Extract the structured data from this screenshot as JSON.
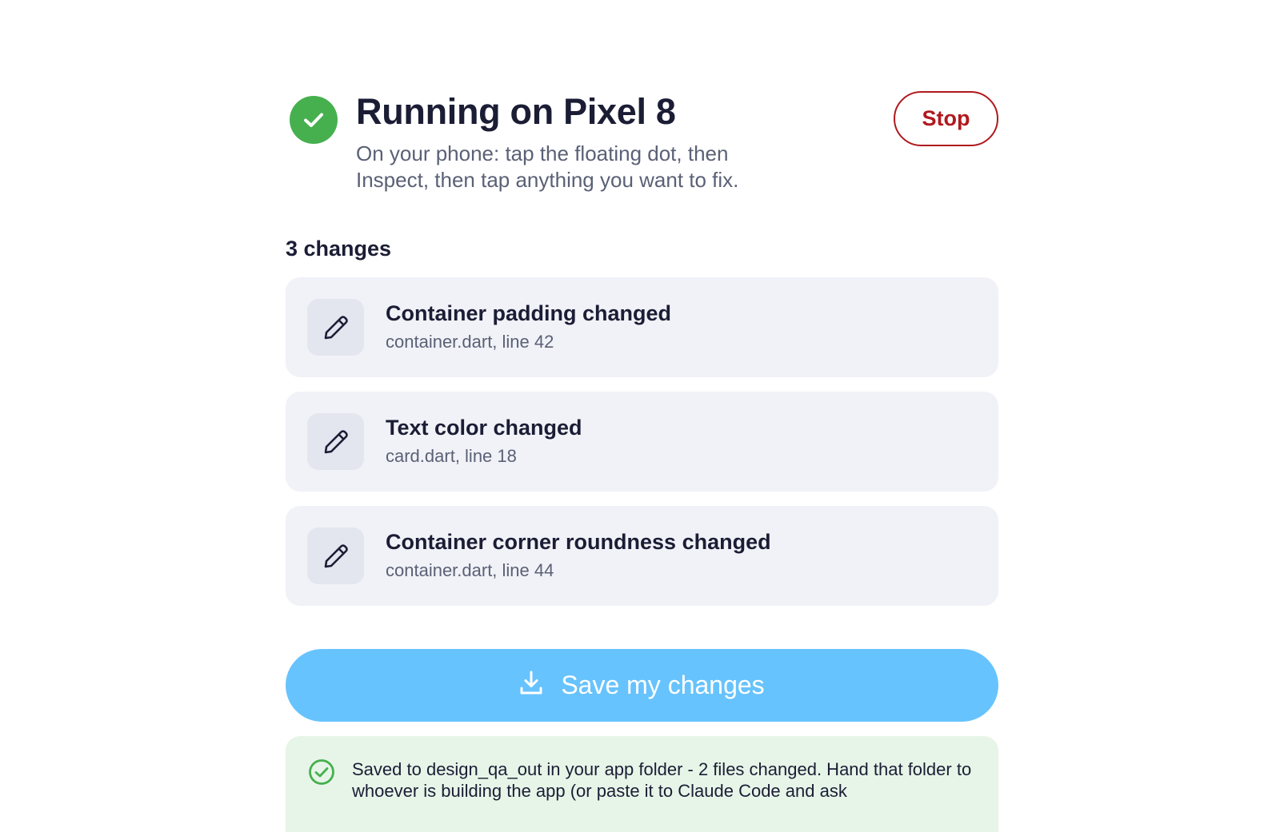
{
  "header": {
    "status_icon": "check-circle-icon",
    "status_color": "#46b04e",
    "title": "Running on Pixel 8",
    "subtitle": "On your phone: tap the floating dot, then Inspect, then tap anything you want to fix.",
    "stop_label": "Stop",
    "stop_color": "#b0191e"
  },
  "changes": {
    "heading": "3 changes",
    "items": [
      {
        "icon": "pencil-icon",
        "title": "Container padding changed",
        "location": "container.dart, line 42"
      },
      {
        "icon": "pencil-icon",
        "title": "Text color changed",
        "location": "card.dart, line 18"
      },
      {
        "icon": "pencil-icon",
        "title": "Container corner roundness changed",
        "location": "container.dart, line 44"
      }
    ]
  },
  "save": {
    "icon": "download-icon",
    "label": "Save my changes",
    "color": "#67c3fd"
  },
  "notice": {
    "icon": "check-circle-outline-icon",
    "text": "Saved to design_qa_out in your app folder - 2 files changed. Hand that folder to whoever is building the app (or paste it to Claude Code and ask"
  }
}
